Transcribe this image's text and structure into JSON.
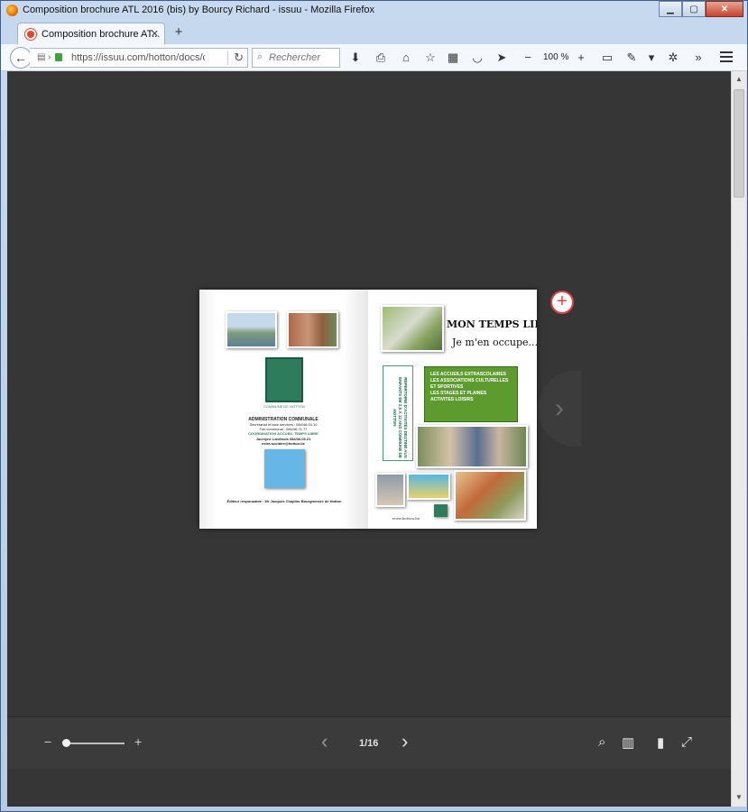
{
  "window": {
    "title": "Composition brochure ATL 2016 (bis) by Bourcy Richard - issuu - Mozilla Firefox",
    "minimize": "▁",
    "maximize": "▢",
    "close": "✕"
  },
  "tab": {
    "label": "Composition brochure AT...",
    "close": "✕",
    "newtab": "+"
  },
  "navbar": {
    "back": "←",
    "url": "https://issuu.com/hotton/docs/cor",
    "reload": "↻",
    "search_placeholder": "Rechercher",
    "zoom": "100 %",
    "zoom_minus": "−",
    "zoom_plus": "+",
    "overflow": "»"
  },
  "document": {
    "admin_title": "ADMINISTRATION COMMUNALE",
    "admin_line1": "Secrétariat et taxe services : 084/46.04.10",
    "admin_line2": "Fax communal : 084/46.71.77",
    "coord_title": "COORDINATION ACCUEIL TEMPS LIBRE",
    "coord_name": "Jocelyne Lardinois 084/36.03.21",
    "coord_email": "extra.scolaire@hotton.be",
    "editor": "Éditeur responsable : Mr Jacques Chaplier Bourgmestre de Hotton",
    "commune_label": "COMMUNE DE HOTTON",
    "title_line1": "MON TEMPS LIBRE,",
    "title_line2": "Je m'en occupe...",
    "vertical_text": "RÉPERTOIRE D'ACTIVITÉS DESTINÉ AUX ENFANTS DE 2,5 À 12 ANS COMMUNE DE HOTTON",
    "list_items": [
      "LES ACCUEILS EXTRASCOLAIRES",
      "LES ASSOCIATIONS CULTURELLES",
      "ET SPORTIVES",
      "LES STAGES ET PLAINES",
      "ACTIVITES LOISIRS"
    ],
    "website": "www.hotton.be"
  },
  "viewer": {
    "add_button": "+",
    "next_overlay": "›",
    "zoom_out": "−",
    "zoom_in": "+",
    "zoom_level": 0.05,
    "prev_page": "‹",
    "page_indicator": "1/16",
    "next_page": "›"
  },
  "icons": {
    "search": "search-icon",
    "thumbnails": "thumbnails-icon",
    "single_page": "page-icon",
    "fullscreen": "fullscreen-icon"
  },
  "colors": {
    "viewer_bg": "#363636",
    "bottombar_bg": "#3b3b3b",
    "green_accent": "#5d9b2f",
    "commune_green": "#2d7d5c",
    "issuu_red": "#e33e3e"
  }
}
